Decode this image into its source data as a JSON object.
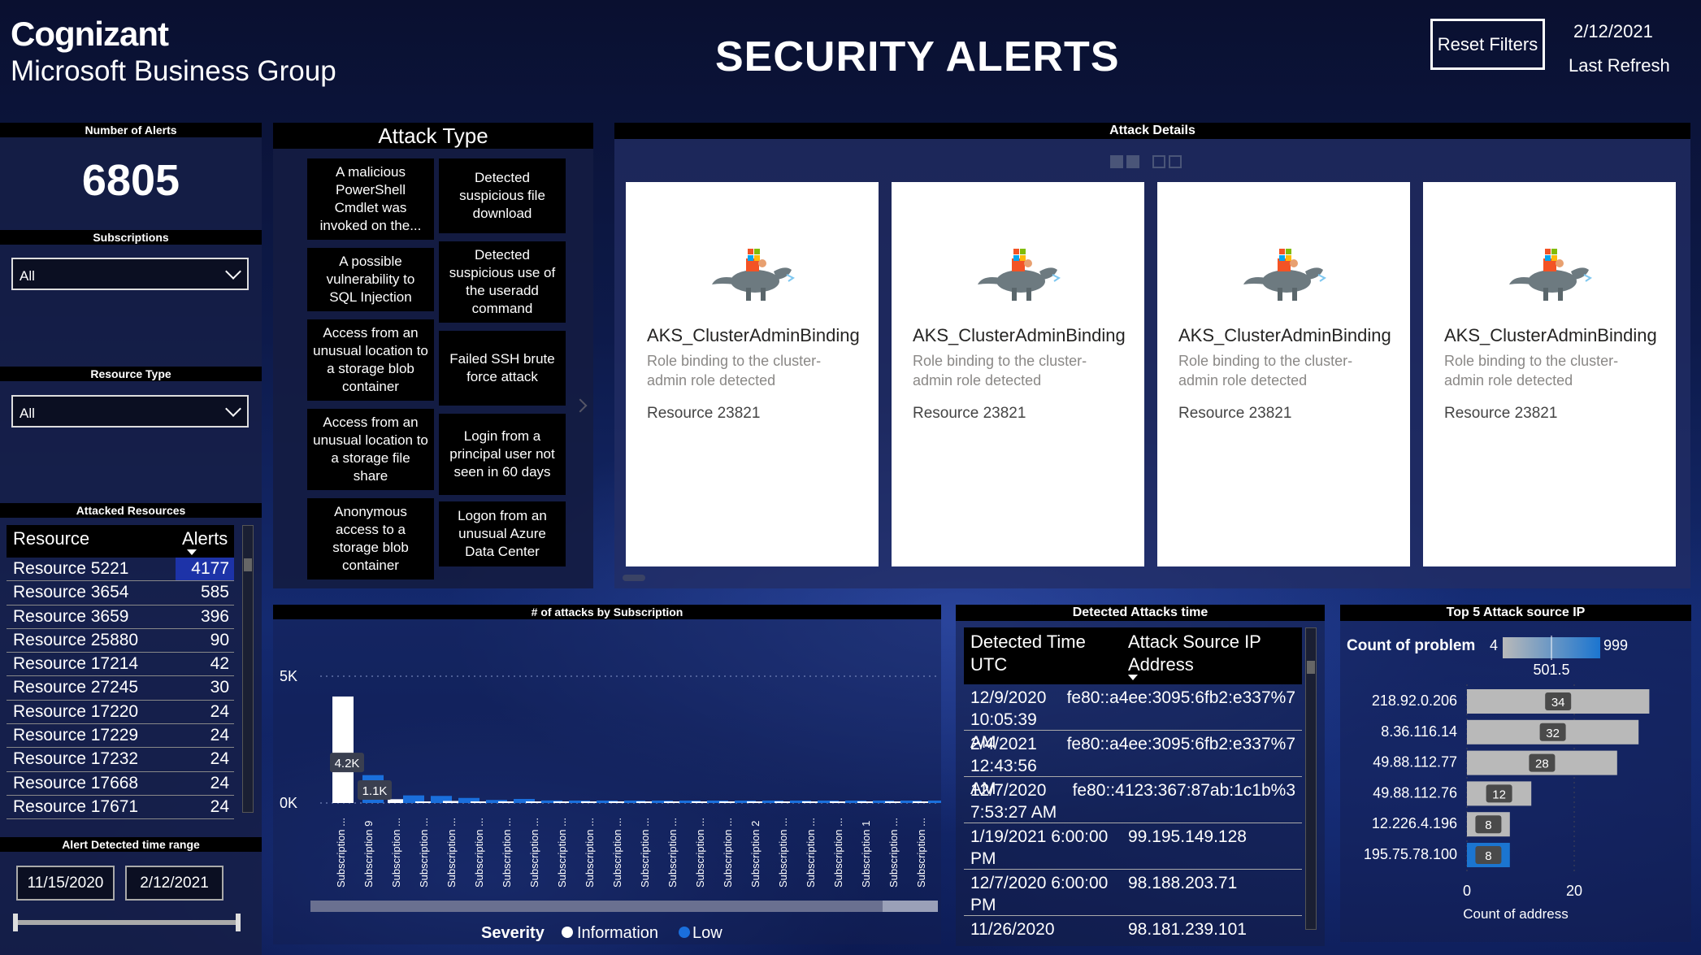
{
  "header": {
    "logo_line1": "Cognizant",
    "logo_line2": "Microsoft Business Group",
    "title": "SECURITY ALERTS",
    "reset_label": "Reset Filters",
    "date": "2/12/2021",
    "refresh_label": "Last Refresh"
  },
  "alerts": {
    "header": "Number of Alerts",
    "count": "6805"
  },
  "subscriptions": {
    "header": "Subscriptions",
    "value": "All"
  },
  "resource_type": {
    "header": "Resource Type",
    "value": "All"
  },
  "attacked_resources": {
    "header": "Attacked Resources",
    "col_resource": "Resource",
    "col_alerts": "Alerts",
    "rows": [
      {
        "name": "Resource 5221",
        "alerts": "4177"
      },
      {
        "name": "Resource 3654",
        "alerts": "585"
      },
      {
        "name": "Resource 3659",
        "alerts": "396"
      },
      {
        "name": "Resource 25880",
        "alerts": "90"
      },
      {
        "name": "Resource 17214",
        "alerts": "42"
      },
      {
        "name": "Resource 27245",
        "alerts": "30"
      },
      {
        "name": "Resource 17220",
        "alerts": "24"
      },
      {
        "name": "Resource 17229",
        "alerts": "24"
      },
      {
        "name": "Resource 17232",
        "alerts": "24"
      },
      {
        "name": "Resource 17668",
        "alerts": "24"
      },
      {
        "name": "Resource 17671",
        "alerts": "24"
      }
    ]
  },
  "time_range": {
    "header": "Alert Detected time range",
    "start": "11/15/2020",
    "end": "2/12/2021"
  },
  "attack_type": {
    "title": "Attack Type",
    "tiles": [
      "A malicious PowerShell Cmdlet was invoked on the...",
      "Detected suspicious file download",
      "A possible vulnerability to SQL Injection",
      "Detected suspicious use of the useradd command",
      "Access from an unusual location to a storage blob container",
      "Failed SSH brute force attack",
      "Access from an unusual location to a storage file share",
      "Login from a principal user not seen in 60 days",
      "Anonymous access to a storage blob container",
      "Logon from an unusual Azure Data Center"
    ]
  },
  "attack_details": {
    "header": "Attack Details",
    "cards": [
      {
        "title": "AKS_ClusterAdminBinding",
        "desc": "Role binding to the cluster-admin role detected",
        "resource": "Resource 23821"
      },
      {
        "title": "AKS_ClusterAdminBinding",
        "desc": "Role binding to the cluster-admin role detected",
        "resource": "Resource 23821"
      },
      {
        "title": "AKS_ClusterAdminBinding",
        "desc": "Role binding to the cluster-admin role detected",
        "resource": "Resource 23821"
      },
      {
        "title": "AKS_ClusterAdminBinding",
        "desc": "Role binding to the cluster-admin role detected",
        "resource": "Resource 23821"
      }
    ]
  },
  "detected_time": {
    "header": "Detected Attacks time",
    "col1": "Detected Time UTC",
    "col2": "Attack Source IP Address",
    "rows": [
      {
        "time": "12/9/2020 10:05:39 AM",
        "ip": "fe80::a4ee:3095:6fb2:e337%7"
      },
      {
        "time": "2/4/2021 12:43:56 AM",
        "ip": "fe80::a4ee:3095:6fb2:e337%7"
      },
      {
        "time": "12/7/2020 7:53:27 AM",
        "ip": "fe80::4123:367:87ab:1c1b%3"
      },
      {
        "time": "1/19/2021 6:00:00 PM",
        "ip": "99.195.149.128"
      },
      {
        "time": "12/7/2020 6:00:00 PM",
        "ip": "98.188.203.71"
      },
      {
        "time": "11/26/2020",
        "ip": "98.181.239.101"
      }
    ]
  },
  "chart_data": [
    {
      "type": "bar",
      "title": "# of attacks by Subscription",
      "legend_title": "Severity",
      "series_names": [
        "Information",
        "Low"
      ],
      "colors": {
        "Information": "#ffffff",
        "Low": "#1a6fdc"
      },
      "yticks": [
        "5K",
        "0K"
      ],
      "ylim": [
        0,
        5000
      ],
      "categories": [
        "Subscription ...",
        "Subscription 9",
        "Subscription ...",
        "Subscription ...",
        "Subscription ...",
        "Subscription ...",
        "Subscription ...",
        "Subscription ...",
        "Subscription ...",
        "Subscription ...",
        "Subscription ...",
        "Subscription ...",
        "Subscription ...",
        "Subscription ...",
        "Subscription ...",
        "Subscription 2",
        "Subscription ...",
        "Subscription ...",
        "Subscription ...",
        "Subscription 1",
        "Subscription ...",
        "Subscription ..."
      ],
      "series": [
        {
          "name": "Information",
          "values": [
            4200,
            0,
            150,
            50,
            80,
            60,
            40,
            30,
            20,
            15,
            12,
            10,
            10,
            8,
            6,
            5,
            5,
            4,
            3,
            3,
            2,
            2
          ]
        },
        {
          "name": "Low",
          "values": [
            0,
            1100,
            300,
            280,
            200,
            120,
            160,
            100,
            60,
            50,
            40,
            30,
            25,
            20,
            15,
            12,
            10,
            10,
            8,
            6,
            5,
            4
          ]
        }
      ],
      "data_labels": [
        {
          "category": 0,
          "text": "4.2K"
        },
        {
          "category": 1,
          "text": "1.1K"
        }
      ]
    },
    {
      "type": "bar",
      "orientation": "horizontal",
      "title": "Top 5 Attack source IP",
      "xlabel": "Count of address",
      "xticks": [
        "0",
        "20"
      ],
      "xlim": [
        0,
        40
      ],
      "gradient_legend": {
        "label": "Count of problem",
        "min": "4",
        "mid": "501.5",
        "max": "999"
      },
      "categories": [
        "218.92.0.206",
        "8.36.116.14",
        "49.88.112.77",
        "49.88.112.76",
        "12.226.4.196",
        "195.75.78.100"
      ],
      "values": [
        34,
        32,
        28,
        12,
        8,
        8
      ],
      "colors": [
        "#b9b9b9",
        "#b9b9b9",
        "#b9b9b9",
        "#b9b9b9",
        "#b9b9b9",
        "#1b75d0"
      ]
    }
  ]
}
